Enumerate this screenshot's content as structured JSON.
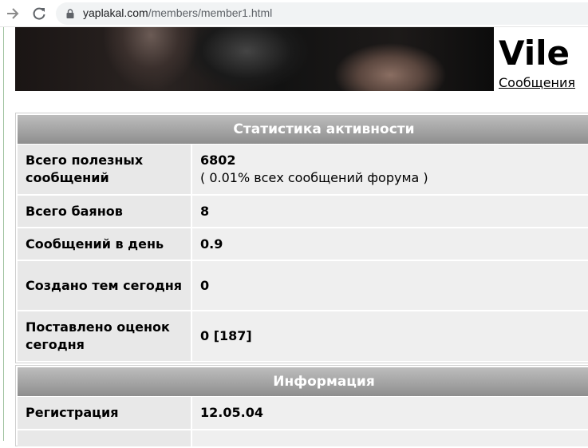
{
  "browser": {
    "url_host": "yaplakal.com",
    "url_path": "/members/member1.html"
  },
  "profile": {
    "username": "Vile",
    "messages_link": "Сообщения"
  },
  "activity": {
    "title": "Статистика активности",
    "rows": [
      {
        "label": "Всего полезных сообщений",
        "value": "6802",
        "note": "( 0.01% всех сообщений форума )"
      },
      {
        "label": "Всего баянов",
        "value": "8"
      },
      {
        "label": "Сообщений в день",
        "value": "0.9"
      },
      {
        "label": "Создано тем сегодня",
        "value": "0"
      },
      {
        "label": "Поставлено оценок сегодня",
        "value": "0 [187]"
      }
    ]
  },
  "info": {
    "title": "Информация",
    "rows": [
      {
        "label": "Регистрация",
        "value": "12.05.04"
      }
    ]
  },
  "icons": {
    "back": "arrow-right-icon",
    "reload": "reload-icon",
    "lock": "lock-icon"
  }
}
